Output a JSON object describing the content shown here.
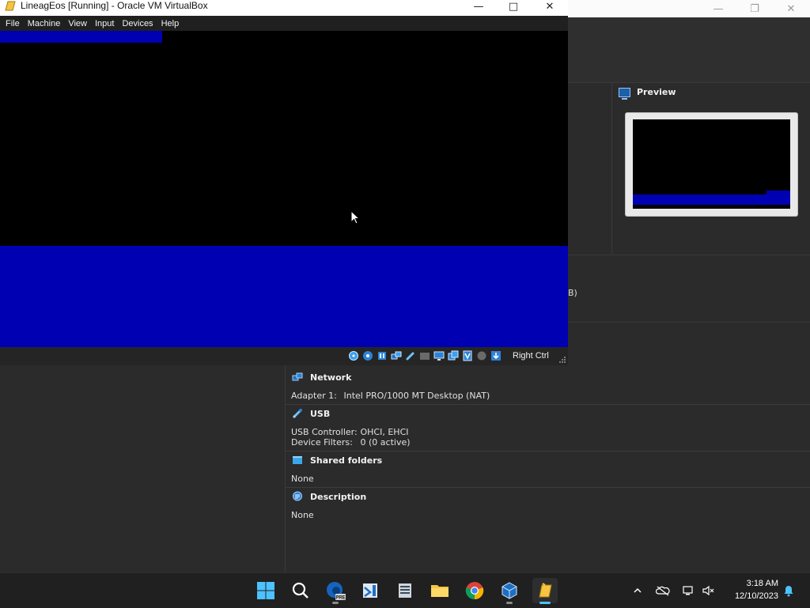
{
  "vm_window": {
    "title": "LineagEos [Running] - Oracle VM VirtualBox",
    "menu": [
      "File",
      "Machine",
      "View",
      "Input",
      "Devices",
      "Help"
    ],
    "host_key_label": "Right Ctrl",
    "screen_colors": {
      "background": "#000000",
      "band": "#0000b3"
    }
  },
  "manager": {
    "preview": {
      "title": "Preview"
    },
    "truncated_text": "B)",
    "sections": {
      "network": {
        "title": "Network",
        "rows": [
          {
            "key": "Adapter 1:",
            "value": "Intel PRO/1000 MT Desktop (NAT)"
          }
        ]
      },
      "usb": {
        "title": "USB",
        "rows": [
          {
            "key": "USB Controller:",
            "value": "OHCI, EHCI"
          },
          {
            "key": "Device Filters:",
            "value": "0 (0 active)"
          }
        ]
      },
      "shared_folders": {
        "title": "Shared folders",
        "value": "None"
      },
      "description": {
        "title": "Description",
        "value": "None"
      }
    }
  },
  "taskbar": {
    "apps": [
      "start-icon",
      "search-icon",
      "edge-dev-icon",
      "visual-studio-icon",
      "app-icon",
      "file-explorer-icon",
      "chrome-icon",
      "virtualbox-icon",
      "virtualbox-manager-icon"
    ],
    "tray_icons": [
      "chevron-up-icon",
      "onedrive-icon",
      "network-icon",
      "speaker-muted-icon",
      "notification-bell-icon"
    ],
    "time": "3:18 AM",
    "date": "12/10/2023",
    "accent": "#4cc2ff"
  }
}
